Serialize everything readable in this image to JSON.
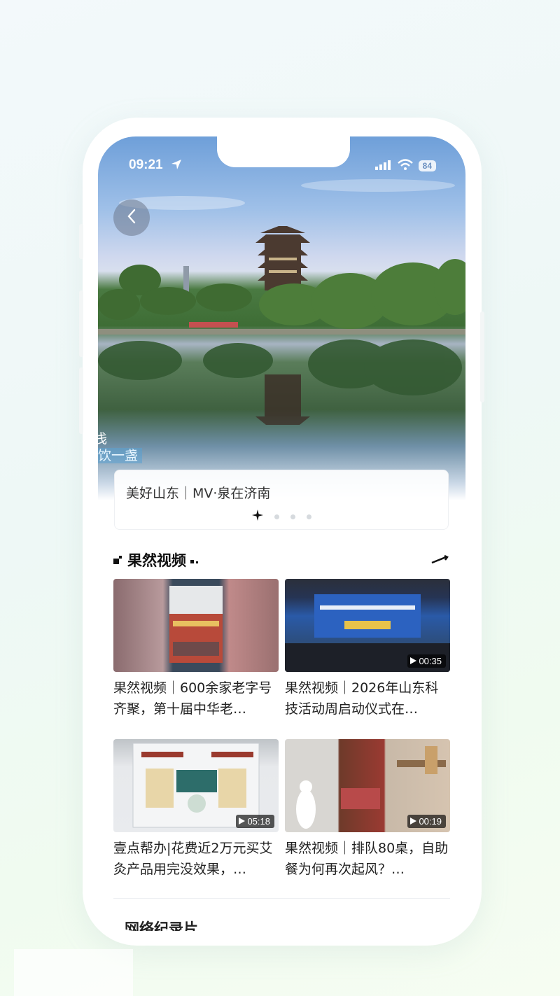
{
  "status_bar": {
    "time": "09:21",
    "battery": "84"
  },
  "hero": {
    "caption_line1": "浅",
    "caption_line2": "饮一盏"
  },
  "feature_card": {
    "title": "美好山东｜MV·泉在济南"
  },
  "section": {
    "title": "果然视频"
  },
  "videos": [
    {
      "title": "果然视频｜600余家老字号齐聚，第十届中华老…",
      "duration": ""
    },
    {
      "title": "果然视频｜2026年山东科技活动周启动仪式在…",
      "duration": "00:35"
    },
    {
      "title": "壹点帮办|花费近2万元买艾灸产品用完没效果，…",
      "duration": "05:18"
    },
    {
      "title": "果然视频｜排队80桌，自助餐为何再次起风？…",
      "duration": "00:19"
    }
  ],
  "next_section": {
    "title": "网络纪录片"
  }
}
